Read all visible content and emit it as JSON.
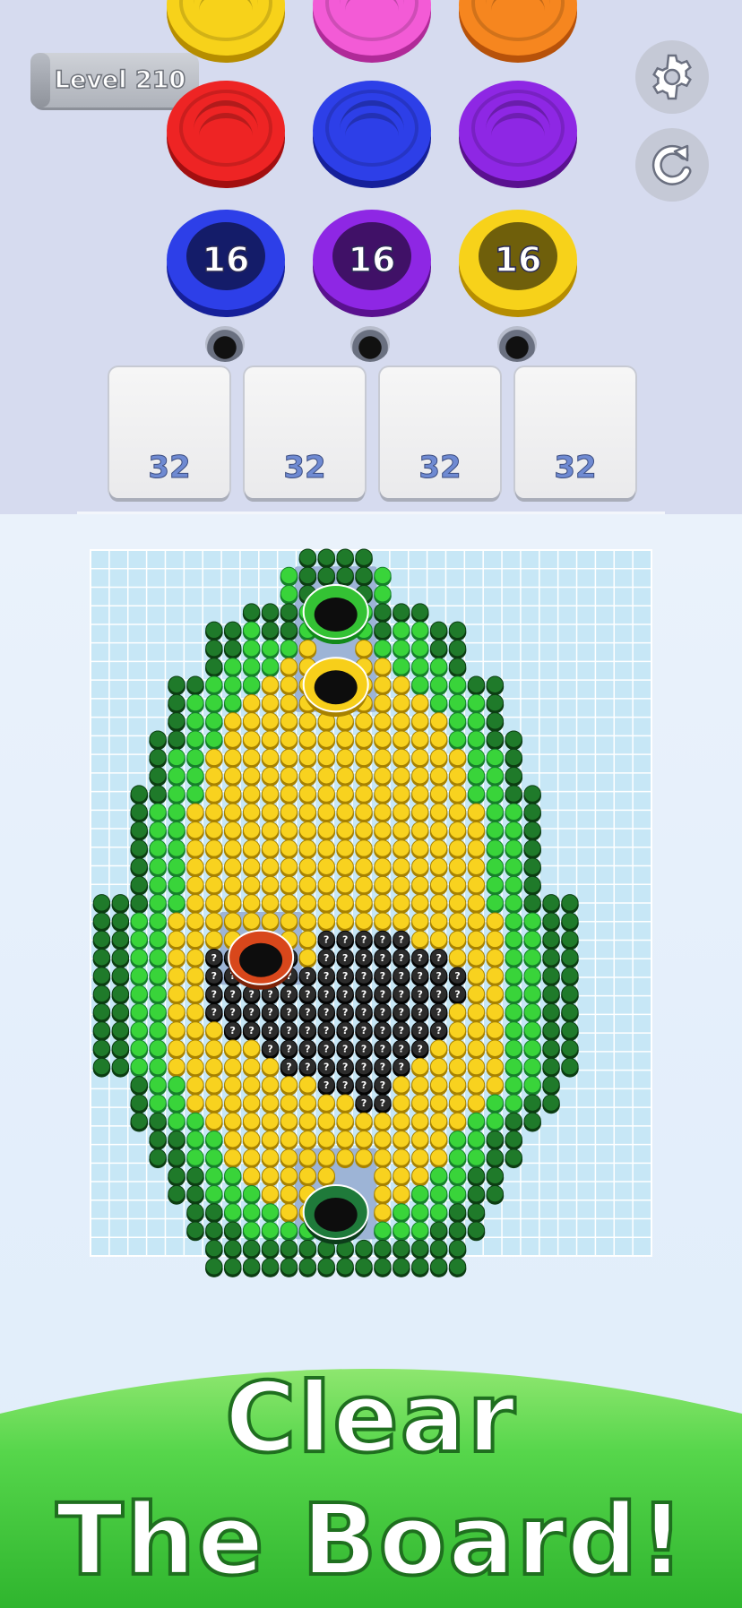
{
  "header": {
    "level_label": "Level 210"
  },
  "queue_coins": {
    "rows": [
      [
        "yellow",
        "magenta",
        "orange"
      ],
      [
        "red",
        "blue",
        "purple"
      ]
    ]
  },
  "active_coins": [
    {
      "color": "blue",
      "count": "16"
    },
    {
      "color": "purple",
      "count": "16"
    },
    {
      "color": "yellow",
      "count": "16"
    }
  ],
  "slots": [
    {
      "count": "32"
    },
    {
      "count": "32"
    },
    {
      "count": "32"
    },
    {
      "count": "32"
    }
  ],
  "board": {
    "legend": {
      "D": "dark-green",
      "G": "green",
      "Y": "yellow",
      "K": "mystery-black"
    },
    "holes": [
      {
        "color": "green",
        "col": 13,
        "row": 3
      },
      {
        "color": "yellow",
        "col": 13,
        "row": 7
      },
      {
        "color": "orange",
        "col": 9,
        "row": 22
      },
      {
        "color": "dark-green",
        "col": 13,
        "row": 36
      }
    ],
    "cells": [
      "...........DDDD...........",
      "..........GDDDDG..........",
      "..........GD..DG..........",
      "........DDDG..GDDD........",
      "......DDGDDG..GDGGDD......",
      "......DDGGGY..YGGGDD......",
      "......DGGGYY..YYGGGD......",
      "....DDGGGYYY..YYYGGGDD....",
      "....DGGGYYYYYYYYYYGGGD....",
      "....DGGYYYYYYYYYYYYGGD....",
      "...DDGGYYYYYYYYYYYYGGDD...",
      "...DGGYYYYYYYYYYYYYYGGD...",
      "...DGGYYYYYYYYYYYYYYGGD...",
      "..DDGGYYYYYYYYYYYYYYGGDD..",
      "..DGGYYYYYYYYYYYYYYYYGGD..",
      "..DGGYYYYYYYYYYYYYYYYGGD..",
      "..DGGYYYYYYYYYYYYYYYYGGD..",
      "..DGGYYYYYYYYYYYYYYYYGGD..",
      "..DGGYYYYYYYYYYYYYYYYGGD..",
      "DDDGGYYYYYYYYYYYYYYYYGGDDD",
      "DDGGYYYYYYYYYYYYYYYYYYGGDD",
      "DDGGYYYY..YYKKKKKYYYYYGGDD",
      "DDGGYYKK..KYKKKKKKKYYYGGDD",
      "DDGGYYKKKKKKKKKKKKKKYYGGDD",
      "DDGGYYKKKKKKKKKKKKKKYYGGDD",
      "DDGGYYKKKKKKKKKKKKKYYYGGDD",
      "DDGGYYYKKKKKKKKKKKKYYYGGDD",
      "DDGGYYYYYKKKKKKKKKYYYYGGDD",
      "DDGGYYYYYYKKKKKKKYYYYYGGDD",
      "..DGGYYYYYYYKKKKYYYYYYGGD.",
      "..DGGYYYYYYYYYKKYYYYYGGDD.",
      "..DDGGYYYYYYYYYYYYYYGGDD..",
      "...DDGGYYYYYYYYYYYYGGDD...",
      "...DDGGYYYYYYYYYYYYGGDD...",
      "....DDGGYYYYY..YYYGGDD....",
      "....DDGGGYYYY..YYGGGDD....",
      ".....DDGGGYYY..YGGGDD.....",
      ".....DDDGGGGG..GGGDDD.....",
      "......DDDDDDDDDDDDDD......",
      "......DDDDDDDDDDDDDD......"
    ]
  },
  "banner": {
    "line1": "Clear",
    "line2": "The Board!"
  }
}
